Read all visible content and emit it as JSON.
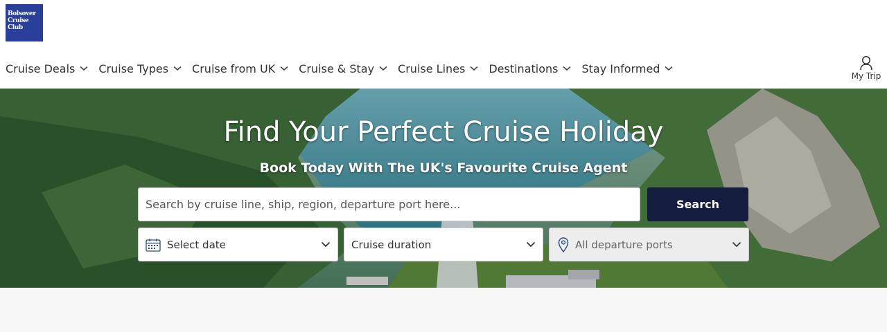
{
  "logo": {
    "lines": [
      "Bolsover",
      "Cruise",
      "Club"
    ]
  },
  "nav": {
    "items": [
      {
        "label": "Cruise Deals"
      },
      {
        "label": "Cruise Types"
      },
      {
        "label": "Cruise from UK"
      },
      {
        "label": "Cruise & Stay"
      },
      {
        "label": "Cruise Lines"
      },
      {
        "label": "Destinations"
      },
      {
        "label": "Stay Informed"
      }
    ],
    "my_trip": "My Trip"
  },
  "hero": {
    "title": "Find Your Perfect Cruise Holiday",
    "subtitle": "Book Today With The UK's Favourite Cruise Agent"
  },
  "search": {
    "placeholder": "Search by cruise line, ship, region, departure port here...",
    "button": "Search"
  },
  "filters": {
    "date": "Select date",
    "duration": "Cruise duration",
    "ports": "All departure ports"
  },
  "colors": {
    "brand_navy": "#141c40",
    "logo_blue": "#2a3f99"
  }
}
